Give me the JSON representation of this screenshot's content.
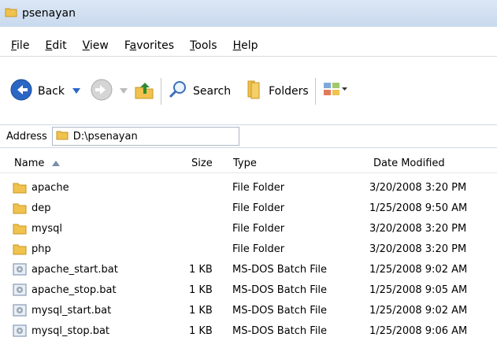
{
  "window": {
    "title": "psenayan"
  },
  "menu": [
    {
      "label": "File",
      "accel": "F"
    },
    {
      "label": "Edit",
      "accel": "E"
    },
    {
      "label": "View",
      "accel": "V"
    },
    {
      "label": "Favorites",
      "accel": "a"
    },
    {
      "label": "Tools",
      "accel": "T"
    },
    {
      "label": "Help",
      "accel": "H"
    }
  ],
  "toolbar": {
    "back_label": "Back",
    "search_label": "Search",
    "folders_label": "Folders"
  },
  "address": {
    "label": "Address",
    "path": "D:\\psenayan"
  },
  "columns": {
    "name": "Name",
    "size": "Size",
    "type": "Type",
    "date": "Date Modified"
  },
  "files": [
    {
      "name": "apache",
      "size": "",
      "type": "File Folder",
      "date": "3/20/2008 3:20 PM",
      "kind": "folder"
    },
    {
      "name": "dep",
      "size": "",
      "type": "File Folder",
      "date": "1/25/2008 9:50 AM",
      "kind": "folder"
    },
    {
      "name": "mysql",
      "size": "",
      "type": "File Folder",
      "date": "3/20/2008 3:20 PM",
      "kind": "folder"
    },
    {
      "name": "php",
      "size": "",
      "type": "File Folder",
      "date": "3/20/2008 3:20 PM",
      "kind": "folder"
    },
    {
      "name": "apache_start.bat",
      "size": "1 KB",
      "type": "MS-DOS Batch File",
      "date": "1/25/2008 9:02 AM",
      "kind": "bat"
    },
    {
      "name": "apache_stop.bat",
      "size": "1 KB",
      "type": "MS-DOS Batch File",
      "date": "1/25/2008 9:05 AM",
      "kind": "bat"
    },
    {
      "name": "mysql_start.bat",
      "size": "1 KB",
      "type": "MS-DOS Batch File",
      "date": "1/25/2008 9:02 AM",
      "kind": "bat"
    },
    {
      "name": "mysql_stop.bat",
      "size": "1 KB",
      "type": "MS-DOS Batch File",
      "date": "1/25/2008 9:06 AM",
      "kind": "bat"
    }
  ],
  "colors": {
    "titlebar": "#dbe7f5",
    "folder": "#f0c24e",
    "accent": "#2b66c4"
  },
  "icons": [
    "folder-icon",
    "back-icon",
    "forward-icon",
    "up-folder-icon",
    "search-icon",
    "folders-icon",
    "views-icon",
    "batch-file-icon",
    "sort-ascending-icon"
  ]
}
